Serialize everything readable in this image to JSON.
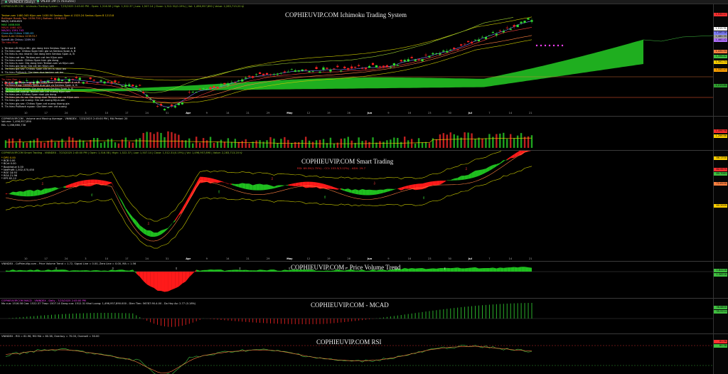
{
  "tabs": [
    {
      "label": "VNINDEX (Daily)",
      "active": true
    },
    {
      "label": "VN30F1M (5 minutes)",
      "active": false
    }
  ],
  "panes": {
    "ichimoku": {
      "title": "COPHIEUVIP.COM Ichimoku Trading System",
      "header": "COPHIEUVIP.COM - Ichimoku Trading System - 7/23/2025 2:45:00 PM - Open: 1,516.58 | High: 1,522.37 | Low: 1,507.14 | Close: 1,512.31(0.19%) | Vol: 1,496,957,890 | Value: 2,283,713.20 tỷ",
      "info_lines": [
        "Tenkan-sen 1480.345 Kijun-sen 1430.50 Senkou Span A 1525.24 Senkou Span B 1213.8",
        "Bollinger Bands Top: 1536.730 | Bottom: 1396.823",
        "MA(5) 1494.625",
        "MA5 1488.800",
        "MA20 1460.423",
        "MA(50) 1391.743",
        "Close-Ab Chikou 1580.83",
        "Span A-Ab Chikou 1239.917",
        "SpanB-Ab Chikou 1289.30",
        "Tin hieu Mua"
      ],
      "alert_lines": [
        "1. Tenkan cắt Kijun lên: gia dong tren Senkou Span A va B",
        "2. Tin hieu cao: Chikou Span tren gia va Senkou Span A, B",
        "3. Tin hieu tu mo nhanh: Gia dong tren Senkou Span A, B",
        "4. Tin hieu cat len: Tenkan-sen cat len Kijun-sen",
        "5. Tin hieu manh: Chikou Span tren gia dong",
        "6. Tin hieu tu sac: Gia dong tren Tenkan-sen va Kijun-sen",
        "7. Tin hieu gia tang: Gia cat len Kijun-sen",
        "8. Tin hieu gia sac: Chikou Span cat len tu duoi len",
        "9. Tin hieu Pullback: Gia tiem dua tenkan cat len"
      ],
      "alert_lines_2": [
        "Tin hieu Ban",
        "1. Tenkan cat Kijun xuong: gia dong duoi Senkou Span A va B",
        "2. Tin hieu thap: Chikou Span duoi gia va Senkou Span A, B",
        "3. Tin hieu giam manh: Gia dong duoi Senkou Span A, B",
        "4. Tin hieu cat xuong: Tenkan-sen cat xuong Kijun-sen",
        "5. Tin hieu yeu: Chikou Span duoi gia dong",
        "6. Tin hieu yeu tu xa: Gia dong duoi Tenkan-sen va Kijun-sen",
        "7. Tin hieu gia cat xuong: Gia cat xuong Kijun-sen",
        "8. Tin hieu gia sac: Chikou Span cat xuong duong gia",
        "9. Tin hieu Pullback nguoc: Gia tiem nen cat xuong"
      ],
      "price_labels": [
        {
          "text": "1,530.17",
          "color": "#ff3030"
        },
        {
          "text": "1,512.31",
          "color": "#ffffff"
        },
        {
          "text": "1,495.46",
          "color": "#8080ff"
        },
        {
          "text": "1,480.35",
          "color": "#a0a0a0"
        },
        {
          "text": "1,460.42",
          "color": "#b070ff"
        },
        {
          "text": "1,430.50",
          "color": "#ff8040"
        },
        {
          "text": "1,396.82",
          "color": "#40c040"
        },
        {
          "text": "1,391.74",
          "color": "#ffd000"
        },
        {
          "text": "1,332.47",
          "color": "#ffa000"
        },
        {
          "text": "1,213.80",
          "color": "#30a030"
        }
      ],
      "dates": [
        "10",
        "17",
        "24",
        "3",
        "10",
        "17",
        "24",
        "31",
        "Apr",
        "9",
        "14",
        "21",
        "29",
        "May",
        "12",
        "19",
        "26",
        "Jun",
        "9",
        "16",
        "23",
        "30",
        "Jul",
        "7",
        "14",
        "21"
      ]
    },
    "volume": {
      "header": "COPHIEUVIP.COM - Volume and Moving Average - VNINDEX - 7/23/2025 2:45:00 PM | MA Period: 20",
      "lines": [
        "Volume: 1,496,957,890",
        "MA: 1,266,660,736"
      ],
      "labels": [
        {
          "text": "1,496.96",
          "color": "#ff3030"
        },
        {
          "text": "1,266.66",
          "color": "#ffd000"
        }
      ]
    },
    "smart": {
      "title": "COPHIEUVIP.COM Smart Trading",
      "subtitle": "RSI: 69.59(1.75%)  - CCI: 153.5(3.12%) - ADX: 29.7",
      "header": "COPHIEUVIP.COM Smart Trading - VNINDEX - 7/23/2025 2:45:00 PM | Open: 1,516.58 | High: 1,522.37 | Low: 1,507.14 | Close: 1,512.31(0.19%) | Vol: 1,496,957,890 | Value: 2,283,713.20 tỷ",
      "lines": [
        "* DPO  0.00",
        "* BCB  0.00",
        "* BCnt  0.00",
        "* BookValue  0.00",
        "* NetProfit  1,502,470,450",
        "* ROE  18.93",
        "* ROA  21.96",
        "* EPS  82.12"
      ],
      "labels": [
        {
          "text": "86.1700",
          "color": "#ffd000"
        },
        {
          "text": "82.9575",
          "color": "#ff3030"
        },
        {
          "text": "80.7083",
          "color": "#40c040"
        },
        {
          "text": "72.8100",
          "color": "#ff8040"
        },
        {
          "text": "60.2009",
          "color": "#ffd000"
        }
      ]
    },
    "pvt": {
      "title": "COPHIEUVIP.COM - Price Volume Trend",
      "header": "VNINDEX - CoPhieuVip.com - Price Volume Trend = 1.72, Signal Line = 0.00, Zero Line = 0.00, MA = 1.56",
      "labels": [
        {
          "text": "1.84118",
          "color": "#40c040"
        },
        {
          "text": "1.56218",
          "color": "#40c040"
        }
      ]
    },
    "macd": {
      "title": "COPHIEUVIP.COM - MCAD",
      "header": "COPHIEUVIP.COM MACD - VNINDEX - Daily - 7/23/2025 2:45:00 PM",
      "line2": "Mo cua: 1516.58  Cao: 1522.37  Thap: 1507.14  Dong cua: 1512.31  Khoi Luong: 1,496,957,890.000 - Dien Tien: 56787.90-4.00 - Do Hay Ao: 2.77 (0.18%)",
      "labels": [
        {
          "text": "38.6800",
          "color": "#40c040"
        },
        {
          "text": "35.9114",
          "color": "#40c040"
        }
      ]
    },
    "rsi": {
      "title": "COPHIEUVIP.COM RSI",
      "header": "VNINDEX - RSI = 81.96, RSI MA = 80.38, Overbuy = 70.00, Oversell = 30.00",
      "labels": [
        {
          "text": "81.96",
          "color": "#ff3030"
        },
        {
          "text": "80.38",
          "color": "#40c040"
        }
      ]
    }
  }
}
